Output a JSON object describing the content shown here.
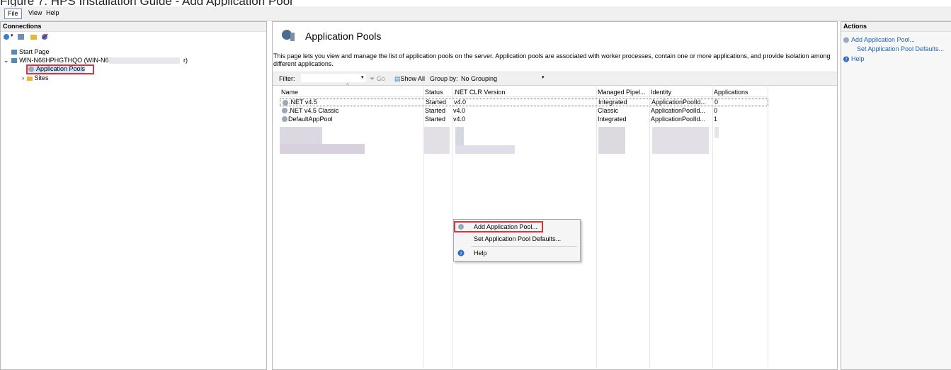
{
  "caption": "Figure 7: HPS Installation Guide - Add Application Pool",
  "menubar": {
    "items": [
      "File",
      "View",
      "Help"
    ]
  },
  "connections": {
    "title": "Connections",
    "tree": {
      "start_page": "Start Page",
      "server": "WIN-N66HPHGTHQO (WIN-N6",
      "server_suffix": "r)",
      "app_pools": "Application Pools",
      "sites": "Sites"
    }
  },
  "main": {
    "title": "Application Pools",
    "description": "This page lets you view and manage the list of application pools on the server. Application pools are associated with worker processes, contain one or more applications, and provide isolation among different applications.",
    "filter_label": "Filter:",
    "go_label": "Go",
    "show_all_label": "Show All",
    "group_by_label": "Group by:",
    "group_by_value": "No Grouping",
    "columns": [
      "Name",
      "Status",
      ".NET CLR Version",
      "Managed Pipel...",
      "Identity",
      "Applications"
    ],
    "rows": [
      {
        "name": ".NET v4.5",
        "status": "Started",
        "clr": "v4.0",
        "pipeline": "Integrated",
        "identity": "ApplicationPoolId...",
        "apps": "0"
      },
      {
        "name": ".NET v4.5 Classic",
        "status": "Started",
        "clr": "v4.0",
        "pipeline": "Classic",
        "identity": "ApplicationPoolId...",
        "apps": "0"
      },
      {
        "name": "DefaultAppPool",
        "status": "Started",
        "clr": "v4.0",
        "pipeline": "Integrated",
        "identity": "ApplicationPoolId...",
        "apps": "1"
      }
    ]
  },
  "context_menu": {
    "items": [
      "Add Application Pool...",
      "Set Application Pool Defaults...",
      "Help"
    ]
  },
  "actions": {
    "title": "Actions",
    "items": [
      "Add Application Pool...",
      "Set Application Pool Defaults...",
      "Help"
    ]
  },
  "colors": {
    "highlight": "#e0313a",
    "link": "#1f64b4",
    "selection": "#cce8ff"
  }
}
